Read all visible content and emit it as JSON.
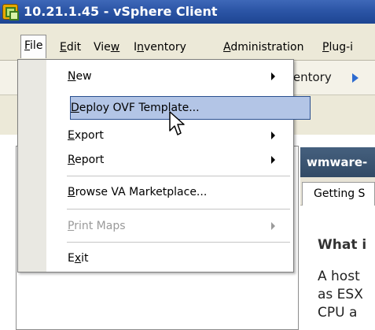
{
  "window": {
    "title": "10.21.1.45 - vSphere Client"
  },
  "menubar": {
    "file": "File",
    "edit": "Edit",
    "view": "View",
    "inventory": "Inventory",
    "administration": "Administration",
    "plugins": "Plug-i"
  },
  "toolbar": {
    "breadcrumb_fragment": "ventory"
  },
  "file_menu": {
    "items": [
      {
        "label": "New",
        "has_submenu": true
      },
      {
        "label": "Deploy OVF Template...",
        "highlighted": true
      },
      {
        "label": "Export",
        "has_submenu": true
      },
      {
        "label": "Report",
        "has_submenu": true
      },
      {
        "label": "Browse VA Marketplace..."
      },
      {
        "label": "Print Maps",
        "has_submenu": true,
        "disabled": true
      },
      {
        "label": "Exit"
      }
    ]
  },
  "right_panel": {
    "header": "wmware-",
    "tab": "Getting S",
    "heading": "What i",
    "lines": [
      "A host",
      "as ESX",
      "CPU a"
    ]
  },
  "colors": {
    "titlebar": "#2c55a6",
    "highlight": "#b3c5e6",
    "right_header": "#3a5470"
  }
}
